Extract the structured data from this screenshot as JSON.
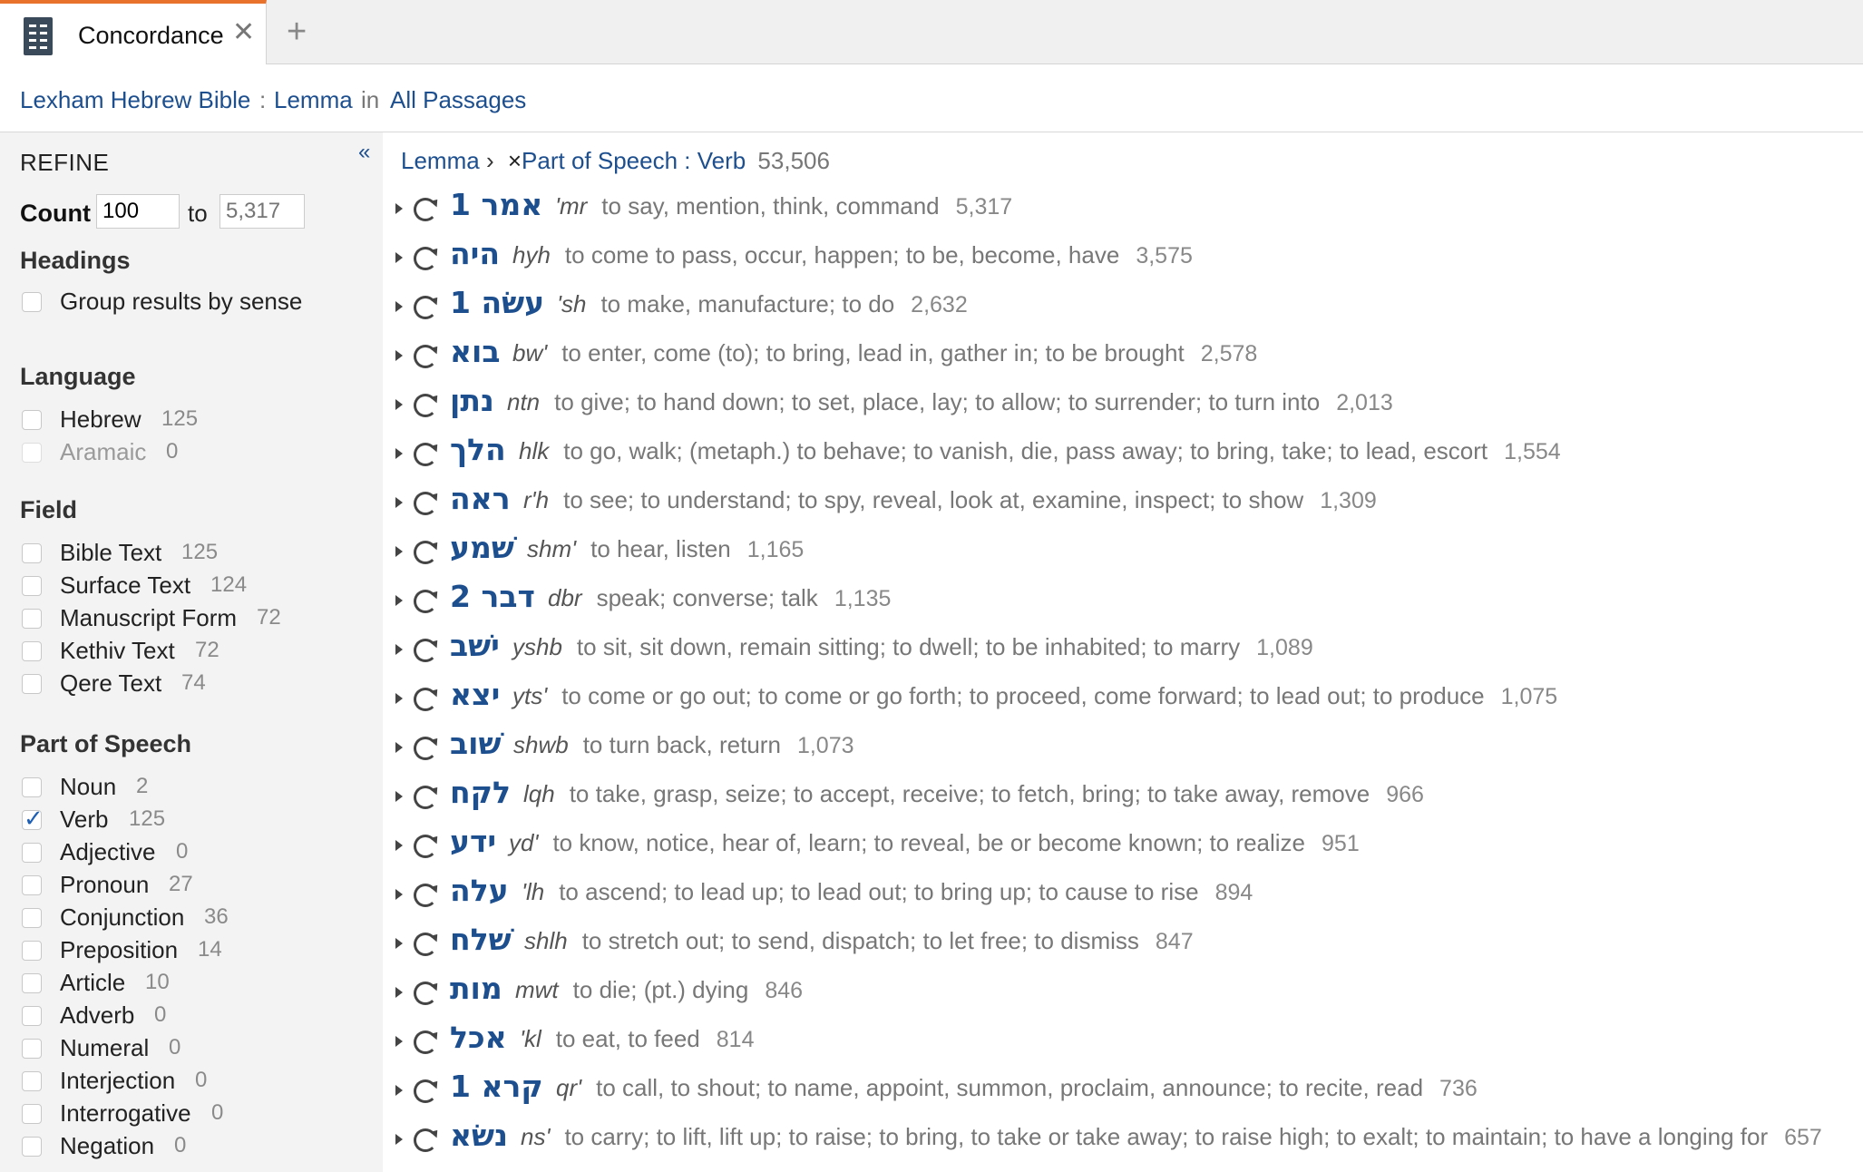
{
  "tab": {
    "title": "Concordance",
    "close": "✕",
    "add": "+"
  },
  "breadcrumb": {
    "resource": "Lexham Hebrew Bible",
    "sep": ":",
    "field": "Lemma",
    "in": "in",
    "scope": "All Passages"
  },
  "sidebar": {
    "collapse": "«",
    "refine": "REFINE",
    "count_label": "Count",
    "count_from": "100",
    "count_to_label": "to",
    "count_to_placeholder": "5,317",
    "headings_title": "Headings",
    "group_by_sense": "Group results by sense",
    "language_title": "Language",
    "languages": [
      {
        "label": "Hebrew",
        "count": "125"
      },
      {
        "label": "Aramaic",
        "count": "0"
      }
    ],
    "field_title": "Field",
    "fields": [
      {
        "label": "Bible Text",
        "count": "125"
      },
      {
        "label": "Surface Text",
        "count": "124"
      },
      {
        "label": "Manuscript Form",
        "count": "72"
      },
      {
        "label": "Kethiv Text",
        "count": "72"
      },
      {
        "label": "Qere Text",
        "count": "74"
      }
    ],
    "pos_title": "Part of Speech",
    "pos": [
      {
        "label": "Noun",
        "count": "2"
      },
      {
        "label": "Verb",
        "count": "125"
      },
      {
        "label": "Adjective",
        "count": "0"
      },
      {
        "label": "Pronoun",
        "count": "27"
      },
      {
        "label": "Conjunction",
        "count": "36"
      },
      {
        "label": "Preposition",
        "count": "14"
      },
      {
        "label": "Article",
        "count": "10"
      },
      {
        "label": "Adverb",
        "count": "0"
      },
      {
        "label": "Numeral",
        "count": "0"
      },
      {
        "label": "Interjection",
        "count": "0"
      },
      {
        "label": "Interrogative",
        "count": "0"
      },
      {
        "label": "Negation",
        "count": "0"
      }
    ]
  },
  "filter": {
    "lemma": "Lemma",
    "arrow": "›",
    "remove": "×",
    "pos_filter": "Part of Speech : Verb",
    "total": "53,506"
  },
  "results": [
    {
      "hebrew": "אמר 1",
      "translit": "'mr",
      "gloss": "to say, mention, think, command",
      "count": "5,317"
    },
    {
      "hebrew": "היה",
      "translit": "hyh",
      "gloss": "to come to pass, occur, happen; to be, become, have",
      "count": "3,575"
    },
    {
      "hebrew": "עשׂה 1",
      "translit": "'sh",
      "gloss": "to make, manufacture; to do",
      "count": "2,632"
    },
    {
      "hebrew": "בוא",
      "translit": "bw'",
      "gloss": "to enter, come (to); to bring, lead in, gather in; to be brought",
      "count": "2,578"
    },
    {
      "hebrew": "נתן",
      "translit": "ntn",
      "gloss": "to give; to hand down; to set, place, lay; to allow; to surrender; to turn into",
      "count": "2,013"
    },
    {
      "hebrew": "הלך",
      "translit": "hlk",
      "gloss": "to go, walk; (metaph.) to behave; to vanish, die, pass away; to bring, take; to lead, escort",
      "count": "1,554"
    },
    {
      "hebrew": "ראה",
      "translit": "r'h",
      "gloss": "to see; to understand; to spy, reveal, look at, examine, inspect; to show",
      "count": "1,309"
    },
    {
      "hebrew": "שׁמע",
      "translit": "shm'",
      "gloss": "to hear, listen",
      "count": "1,165"
    },
    {
      "hebrew": "דבר 2",
      "translit": "dbr",
      "gloss": "speak; converse; talk",
      "count": "1,135"
    },
    {
      "hebrew": "ישׁב",
      "translit": "yshb",
      "gloss": "to sit, sit down, remain sitting; to dwell; to be inhabited; to marry",
      "count": "1,089"
    },
    {
      "hebrew": "יצא",
      "translit": "yts'",
      "gloss": "to come or go out; to come or go forth; to proceed, come forward; to lead out; to produce",
      "count": "1,075"
    },
    {
      "hebrew": "שׁוב",
      "translit": "shwb",
      "gloss": "to turn back, return",
      "count": "1,073"
    },
    {
      "hebrew": "לקח",
      "translit": "lqh",
      "gloss": "to take, grasp, seize; to accept, receive; to fetch, bring; to take away, remove",
      "count": "966"
    },
    {
      "hebrew": "ידע",
      "translit": "yd'",
      "gloss": "to know, notice, hear of, learn; to reveal, be or become known; to realize",
      "count": "951"
    },
    {
      "hebrew": "עלה",
      "translit": "'lh",
      "gloss": "to ascend; to lead up; to lead out; to bring up; to cause to rise",
      "count": "894"
    },
    {
      "hebrew": "שׁלח",
      "translit": "shlh",
      "gloss": "to stretch out; to send, dispatch; to let free; to dismiss",
      "count": "847"
    },
    {
      "hebrew": "מות",
      "translit": "mwt",
      "gloss": "to die; (pt.) dying",
      "count": "846"
    },
    {
      "hebrew": "אכל",
      "translit": "'kl",
      "gloss": "to eat, to feed",
      "count": "814"
    },
    {
      "hebrew": "קרא 1",
      "translit": "qr'",
      "gloss": "to call, to shout; to name, appoint, summon, proclaim, announce; to recite, read",
      "count": "736"
    },
    {
      "hebrew": "נשׂא",
      "translit": "ns'",
      "gloss": "to carry; to lift, lift up; to raise; to bring, to take or take away; to raise high; to exalt; to maintain; to have a longing for",
      "count": "657"
    }
  ]
}
